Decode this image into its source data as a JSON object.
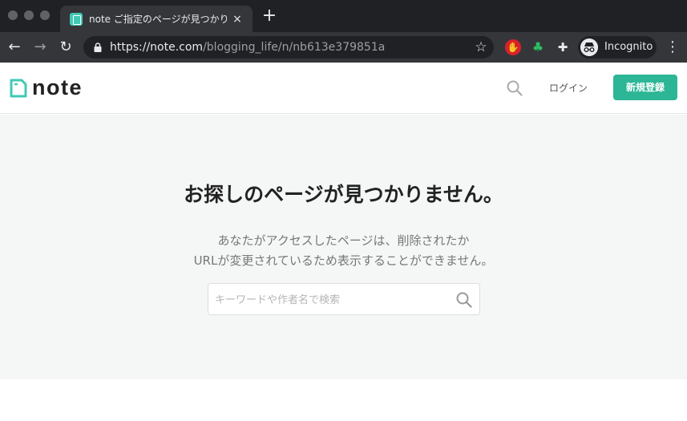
{
  "browser": {
    "tab": {
      "title": "note ご指定のページが見つかり",
      "close": "×"
    },
    "new_tab": "+",
    "nav": {
      "back": "←",
      "forward": "→",
      "reload": "↻"
    },
    "url": {
      "host": "https://note.com",
      "path": "/blogging_life/n/nb613e379851a"
    },
    "bookmark": "☆",
    "incognito_label": "Incognito",
    "menu": "⋮"
  },
  "header": {
    "logo_text": "note",
    "login_label": "ログイン",
    "signup_label": "新規登録",
    "accent_color": "#2cb696"
  },
  "main": {
    "title": "お探しのページが見つかりません。",
    "message_line1": "あなたがアクセスしたページは、削除されたか",
    "message_line2": "URLが変更されているため表示することができません。",
    "search_placeholder": "キーワードや作者名で検索"
  }
}
